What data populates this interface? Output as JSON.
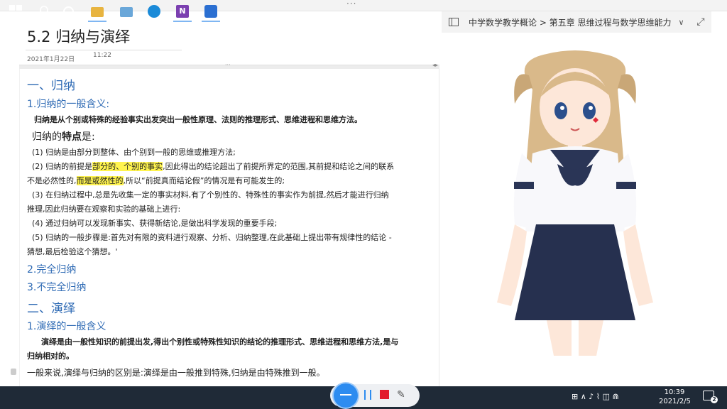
{
  "window": {
    "menu_dots": "···"
  },
  "page": {
    "title": "5.2 归纳与演绎",
    "date": "2021年1月22日",
    "time": "11:22"
  },
  "breadcrumb": {
    "text": "中学数学教学概论 > 第五章 思维过程与数学思维能力",
    "chevron": "∨",
    "expand_icon": "⤢"
  },
  "content": {
    "h1_induction": "一、归纳",
    "h2_general_meaning": "1.归纳的一般含义:",
    "definition": "归纳是从个别或特殊的经验事实出发突出一般性原理、法则的推理形式、思维进程和思维方法。",
    "features_prefix": "归纳的",
    "features_bold": "特点",
    "features_suffix": "是:",
    "item1": "(1) 归纳是由部分到整体、由个别到一般的思维或推理方法;",
    "item2_a": "(2) 归纳的前提是",
    "item2_hl": "部分的、个别的事实",
    "item2_b": ",因此得出的结论超出了前提所界定的范围,其前提和结论之间的联系",
    "item2_c": "不是必然性的,",
    "item2_hl2": "而是或然性的",
    "item2_d": ",所以“前提真而结论假”的情况是有可能发生的;",
    "item3_a": "(3) 在归纳过程中,总是先收集一定的事实材料,有了个别性的、特殊性的事实作为前提,然后才能进行归纳",
    "item3_b": "推理,因此归纳要在观察和实验的基础上进行:",
    "item4": "(4) 通过归纳可以发现新事实、获得新结论,是做出科学发现的重要手段;",
    "item5_a": "(5) 归纳的一般步骤是:首先对有限的资料进行观察、分析、归纳整理,在此基础上提出带有规律性的结论 -",
    "item5_b": "猜想,最后检验这个猜想。'",
    "h2_complete": "2.完全归纳",
    "h2_incomplete": "3.不完全归纳",
    "h1_deduction": "二、演绎",
    "h2_deduction_meaning": "1.演绎的一般含义",
    "deduction_def_a": "演绎是由一般性知识的前提出发,得出个别性或特殊性知识的结论的推理形式、思维进程和思维方法,是与",
    "deduction_def_b": "归纳相对的。",
    "difference": "一般来说,演绎与归纳的区别是:演绎是由一般推到特殊,归纳是由特殊推到一般。"
  },
  "taskbar": {
    "onenote_letter": "N",
    "tray_icons": "⊞ ∧ ♪ ⌇ ◫ ⋒",
    "time": "10:39",
    "date": "2021/2/5",
    "notifications": "2"
  },
  "colors": {
    "heading": "#2e6ab4",
    "highlight": "#fff44f",
    "taskbar": "#1f2a37",
    "record_stop": "#e21b2c"
  }
}
